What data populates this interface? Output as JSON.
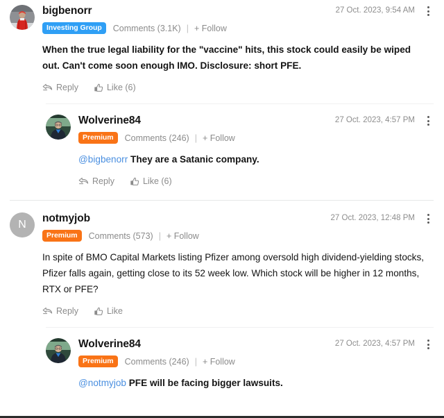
{
  "thread": {
    "comments": [
      {
        "id": "c1",
        "level": 0,
        "username": "bigbenorr",
        "avatar_type": "photo-red-jacket",
        "timestamp": "27 Oct. 2023, 9:54 AM",
        "badge": "Investing Group",
        "badge_color": "#2f9ff5",
        "comments_count": "Comments (3.1K)",
        "separator": "|",
        "follow_label": "+ Follow",
        "mention": "",
        "body": "When the true legal liability for the \"vaccine\" hits, this stock could easily be wiped out. Can't come soon enough IMO. Disclosure: short PFE.",
        "body_bold": true,
        "reply_label": "Reply",
        "like_label": "Like (6)",
        "menu_icon": "kebab-menu-icon"
      },
      {
        "id": "c2",
        "level": 1,
        "username": "Wolverine84",
        "avatar_type": "photo-blue-shirt",
        "timestamp": "27 Oct. 2023, 4:57 PM",
        "badge": "Premium",
        "badge_color": "#f97316",
        "comments_count": "Comments (246)",
        "separator": "|",
        "follow_label": "+ Follow",
        "mention": "@bigbenorr",
        "body": " They are a Satanic company.",
        "body_bold": true,
        "reply_label": "Reply",
        "like_label": "Like (6)",
        "menu_icon": "kebab-menu-icon"
      },
      {
        "id": "c3",
        "level": 0,
        "username": "notmyjob",
        "avatar_type": "initial",
        "avatar_initial": "N",
        "timestamp": "27 Oct. 2023, 12:48 PM",
        "badge": "Premium",
        "badge_color": "#f97316",
        "comments_count": "Comments (573)",
        "separator": "|",
        "follow_label": "+ Follow",
        "mention": "",
        "body": "In spite of BMO Capital Markets listing Pfizer among oversold high dividend-yielding stocks, Pfizer falls again, getting close to its 52 week low. Which stock will be higher in 12 months, RTX or PFE?",
        "body_bold": false,
        "reply_label": "Reply",
        "like_label": "Like",
        "menu_icon": "kebab-menu-icon"
      },
      {
        "id": "c4",
        "level": 1,
        "username": "Wolverine84",
        "avatar_type": "photo-blue-shirt",
        "timestamp": "27 Oct. 2023, 4:57 PM",
        "badge": "Premium",
        "badge_color": "#f97316",
        "comments_count": "Comments (246)",
        "separator": "|",
        "follow_label": "+ Follow",
        "mention": "@notmyjob",
        "body": " PFE will be facing bigger lawsuits.",
        "body_bold": true,
        "reply_label": "",
        "like_label": "",
        "menu_icon": "kebab-menu-icon"
      }
    ]
  }
}
